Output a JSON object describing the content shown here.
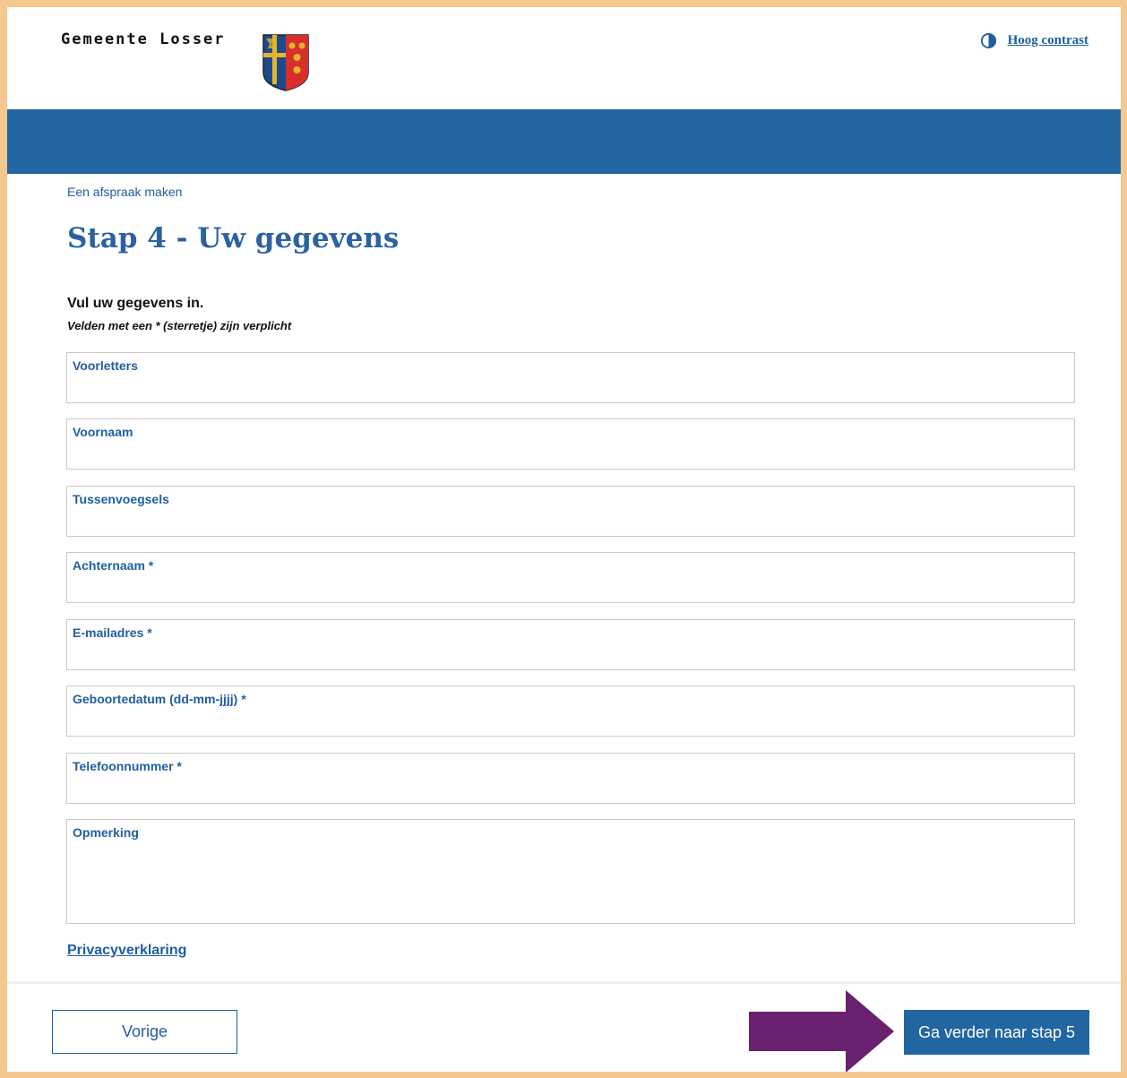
{
  "header": {
    "site_name": "Gemeente Losser",
    "contrast_label": "Hoog contrast"
  },
  "breadcrumb": "Een afspraak maken",
  "page_title": "Stap 4 - Uw gegevens",
  "intro": "Vul uw gegevens in.",
  "required_note": "Velden met een * (sterretje) zijn verplicht",
  "fields": [
    {
      "label": "Voorletters",
      "value": ""
    },
    {
      "label": "Voornaam",
      "value": ""
    },
    {
      "label": "Tussenvoegsels",
      "value": ""
    },
    {
      "label": "Achternaam *",
      "value": ""
    },
    {
      "label": "E-mailadres *",
      "value": ""
    },
    {
      "label": "Geboortedatum (dd-mm-jjjj) *",
      "value": ""
    },
    {
      "label": "Telefoonnummer *",
      "value": ""
    },
    {
      "label": "Opmerking",
      "value": ""
    }
  ],
  "privacy_link": "Privacyverklaring",
  "buttons": {
    "previous": "Vorige",
    "next": "Ga verder naar stap 5"
  },
  "colors": {
    "primary": "#2165a1",
    "frame": "#f5c88f",
    "arrow": "#6a2170"
  },
  "icons": {
    "contrast": "contrast-icon",
    "crest": "crest-logo",
    "annotation": "arrow-right-icon"
  }
}
